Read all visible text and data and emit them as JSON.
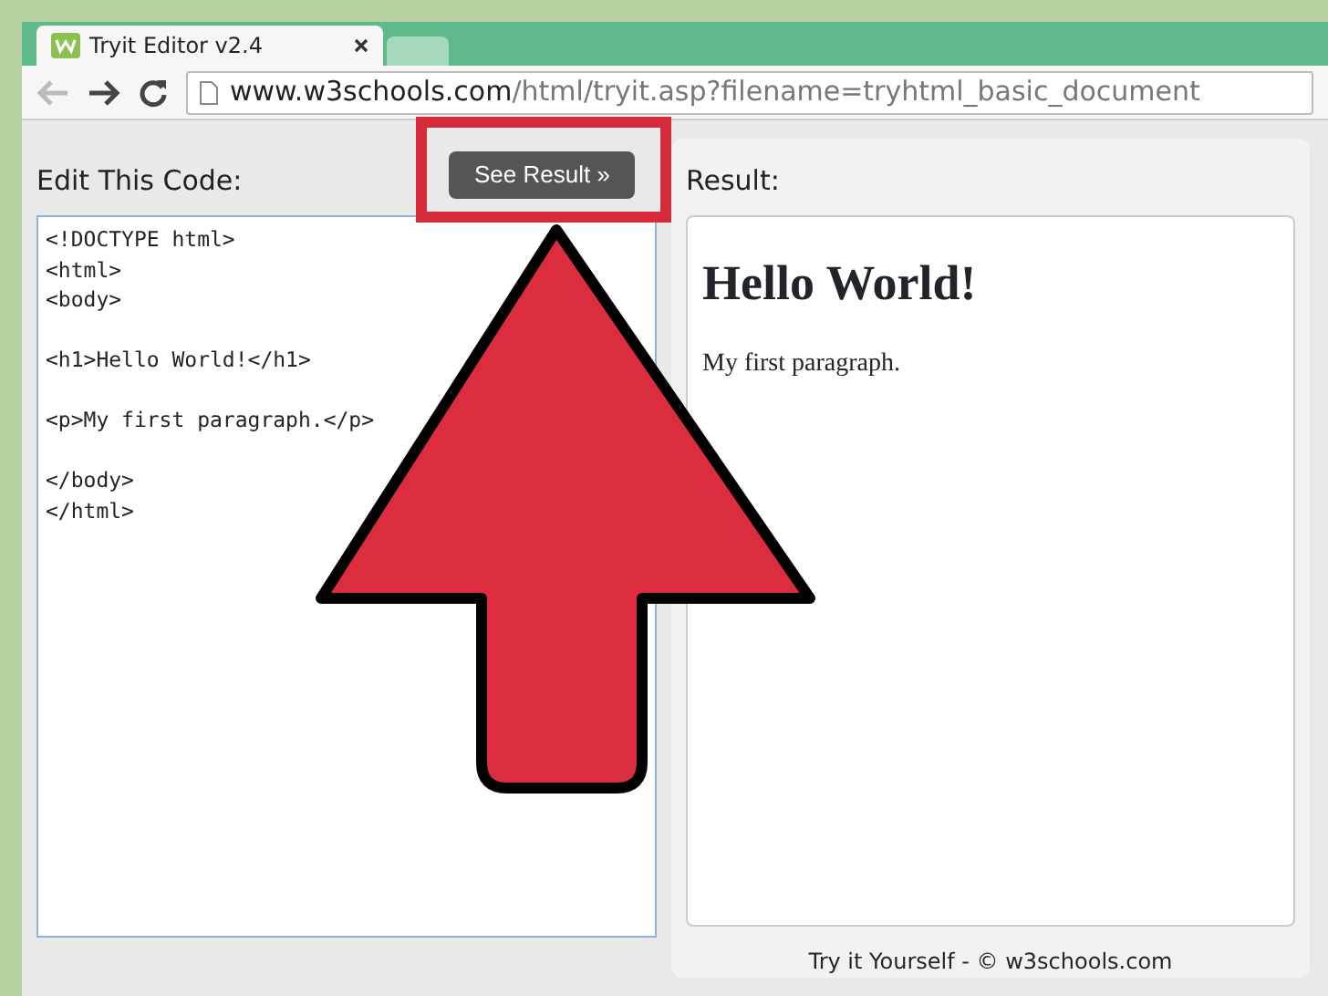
{
  "browser": {
    "tabs": [
      {
        "title": "Tryit Editor v2.4",
        "selected": true
      },
      {
        "selected": false
      }
    ],
    "url": {
      "host": "www.w3schools.com",
      "path": "/html/tryit.asp?filename=tryhtml_basic_document"
    }
  },
  "editor": {
    "label": "Edit This Code:",
    "code_blocks": [
      [
        "<!DOCTYPE html>",
        "<html>",
        "<body>"
      ],
      [
        "<h1>Hello World!</h1>"
      ],
      [
        "<p>My first paragraph.</p>"
      ],
      [
        "</body>",
        "</html>"
      ]
    ]
  },
  "see_result_button": "See Result »",
  "result": {
    "label": "Result:",
    "heading": "Hello World!",
    "paragraph": "My first paragraph."
  },
  "footer": "Try it Yourself - © w3schools.com"
}
